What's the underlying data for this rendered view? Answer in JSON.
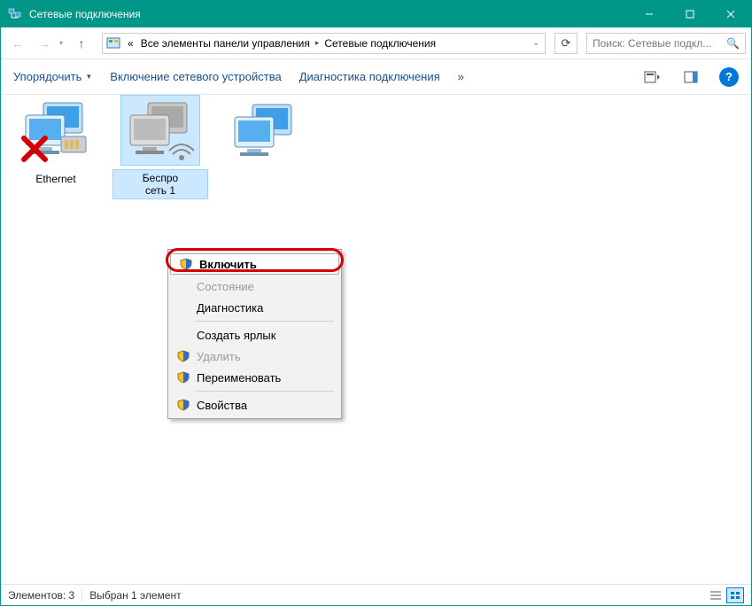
{
  "window": {
    "title": "Сетевые подключения"
  },
  "nav": {
    "breadcrumb_prefix": "«",
    "crumb1": "Все элементы панели управления",
    "crumb2": "Сетевые подключения"
  },
  "search": {
    "placeholder": "Поиск: Сетевые подкл..."
  },
  "toolbar": {
    "organize": "Упорядочить",
    "enable_device": "Включение сетевого устройства",
    "diagnostics": "Диагностика подключения",
    "overflow": "»"
  },
  "connections": [
    {
      "label": "Ethernet"
    },
    {
      "label": "Беспро\nсеть 1"
    },
    {
      "label": ""
    }
  ],
  "context_menu": {
    "enable": "Включить",
    "status": "Состояние",
    "diagnose": "Диагностика",
    "create_shortcut": "Создать ярлык",
    "delete": "Удалить",
    "rename": "Переименовать",
    "properties": "Свойства"
  },
  "status": {
    "count": "Элементов: 3",
    "selection": "Выбран 1 элемент"
  }
}
